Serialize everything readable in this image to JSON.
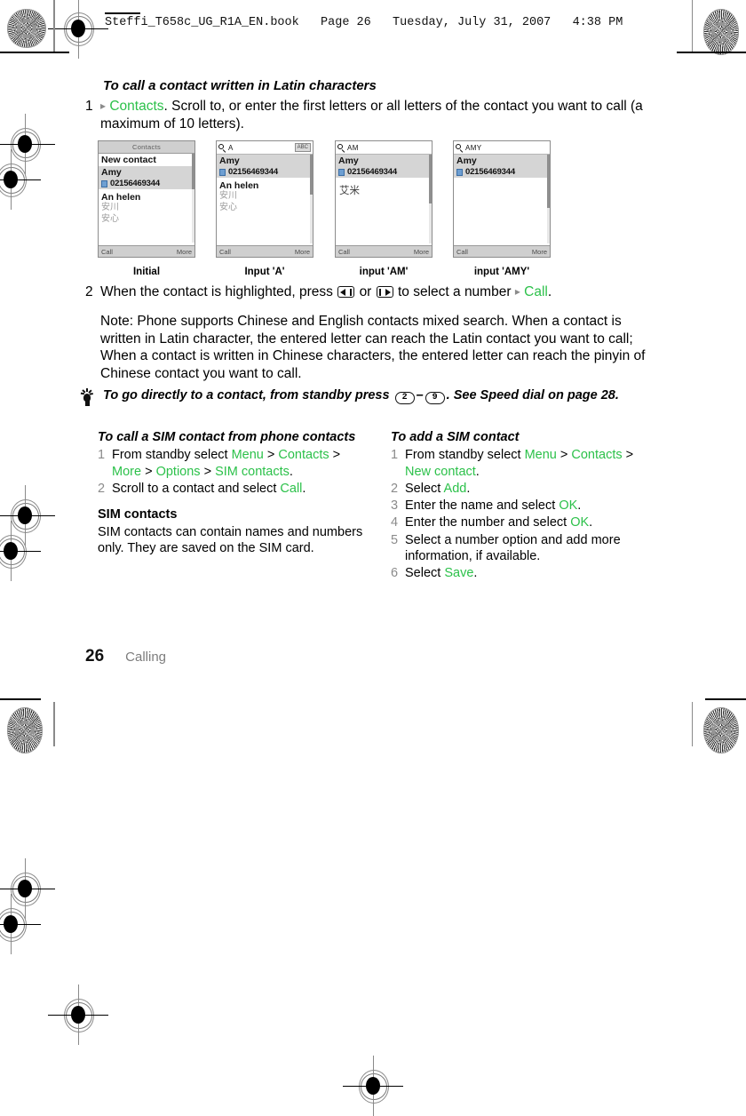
{
  "header": {
    "book_line": "Steffi_T658c_UG_R1A_EN.book   Page 26   Tuesday, July 31, 2007   4:38 PM"
  },
  "section": {
    "heading": "To call a contact written in Latin characters",
    "step1": {
      "number": "1",
      "arrow": "▸",
      "link": "Contacts",
      "text": ". Scroll to, or enter the first letters or all letters of the contact you want to call (a maximum of 10 letters)."
    },
    "step2": {
      "number": "2",
      "pre": "When the contact is highlighted, press",
      "mid": "or",
      "post": "to select a number",
      "arrow": "▸",
      "link": "Call",
      "end": "."
    },
    "note": "Note: Phone supports Chinese and English contacts mixed search. When a contact is written in Latin character, the entered letter can reach the Latin contact you want to call; When a contact is written in Chinese characters, the entered letter can reach the pinyin of Chinese contact you want to call."
  },
  "screenshots": [
    {
      "caption": "Initial",
      "mode": "title",
      "title": "Contacts",
      "query": "",
      "abc": "",
      "first_row": "New contact",
      "selected_name": "Amy",
      "selected_number": "02156469344",
      "below_en": "An helen",
      "below_cn1": "安川",
      "below_cn2": "安心",
      "big_cn": "",
      "softkey_left": "Call",
      "softkey_right": "More"
    },
    {
      "caption": "Input 'A'",
      "mode": "search",
      "title": "",
      "query": "A",
      "abc": "ABC",
      "first_row": "",
      "selected_name": "Amy",
      "selected_number": "02156469344",
      "below_en": "An helen",
      "below_cn1": "安川",
      "below_cn2": "安心",
      "big_cn": "",
      "softkey_left": "Call",
      "softkey_right": "More"
    },
    {
      "caption": "input 'AM'",
      "mode": "search",
      "title": "",
      "query": "AM",
      "abc": "",
      "first_row": "",
      "selected_name": "Amy",
      "selected_number": "02156469344",
      "below_en": "",
      "below_cn1": "",
      "below_cn2": "",
      "big_cn": "艾米",
      "softkey_left": "Call",
      "softkey_right": "More"
    },
    {
      "caption": "input 'AMY'",
      "mode": "search",
      "title": "",
      "query": "AMY",
      "abc": "",
      "first_row": "",
      "selected_name": "Amy",
      "selected_number": "02156469344",
      "below_en": "",
      "below_cn1": "",
      "below_cn2": "",
      "big_cn": "",
      "softkey_left": "Call",
      "softkey_right": "More"
    }
  ],
  "tip": {
    "pre": "To go directly to a contact, from standby press",
    "key_from": "2",
    "dash": "–",
    "key_to": "9",
    "post": ". See Speed dial on page 28."
  },
  "left_column": {
    "heading": "To call a SIM contact from phone contacts",
    "items": [
      {
        "number": "1",
        "parts": [
          {
            "t": "From standby select ",
            "c": "plain"
          },
          {
            "t": "Menu",
            "c": "green"
          },
          {
            "t": " > ",
            "c": "plain"
          },
          {
            "t": "Contacts",
            "c": "green"
          },
          {
            "t": " > ",
            "c": "plain"
          },
          {
            "t": "More",
            "c": "green"
          },
          {
            "t": " > ",
            "c": "plain"
          },
          {
            "t": "Options",
            "c": "green"
          },
          {
            "t": " > ",
            "c": "plain"
          },
          {
            "t": "SIM contacts",
            "c": "green"
          },
          {
            "t": ".",
            "c": "plain"
          }
        ]
      },
      {
        "number": "2",
        "parts": [
          {
            "t": "Scroll to a contact and select ",
            "c": "plain"
          },
          {
            "t": "Call",
            "c": "green"
          },
          {
            "t": ".",
            "c": "plain"
          }
        ]
      }
    ],
    "sub_heading": "SIM contacts",
    "sub_text": "SIM contacts can contain names and numbers only. They are saved on the SIM card."
  },
  "right_column": {
    "heading": "To add a SIM contact",
    "items": [
      {
        "number": "1",
        "parts": [
          {
            "t": "From standby select ",
            "c": "plain"
          },
          {
            "t": "Menu",
            "c": "green"
          },
          {
            "t": " > ",
            "c": "plain"
          },
          {
            "t": "Contacts",
            "c": "green"
          },
          {
            "t": " > ",
            "c": "plain"
          },
          {
            "t": "New contact",
            "c": "green"
          },
          {
            "t": ".",
            "c": "plain"
          }
        ]
      },
      {
        "number": "2",
        "parts": [
          {
            "t": "Select ",
            "c": "plain"
          },
          {
            "t": "Add",
            "c": "green"
          },
          {
            "t": ".",
            "c": "plain"
          }
        ]
      },
      {
        "number": "3",
        "parts": [
          {
            "t": "Enter the name and select ",
            "c": "plain"
          },
          {
            "t": "OK",
            "c": "green"
          },
          {
            "t": ".",
            "c": "plain"
          }
        ]
      },
      {
        "number": "4",
        "parts": [
          {
            "t": "Enter the number and select ",
            "c": "plain"
          },
          {
            "t": "OK",
            "c": "green"
          },
          {
            "t": ".",
            "c": "plain"
          }
        ]
      },
      {
        "number": "5",
        "parts": [
          {
            "t": "Select a number option and add more information, if available.",
            "c": "plain"
          }
        ]
      },
      {
        "number": "6",
        "parts": [
          {
            "t": "Select ",
            "c": "plain"
          },
          {
            "t": "Save",
            "c": "green"
          },
          {
            "t": ".",
            "c": "plain"
          }
        ]
      }
    ]
  },
  "footer": {
    "page_number": "26",
    "chapter": "Calling"
  },
  "colors": {
    "link_green": "#2cc14a",
    "muted_gray": "#8b8b8b"
  }
}
